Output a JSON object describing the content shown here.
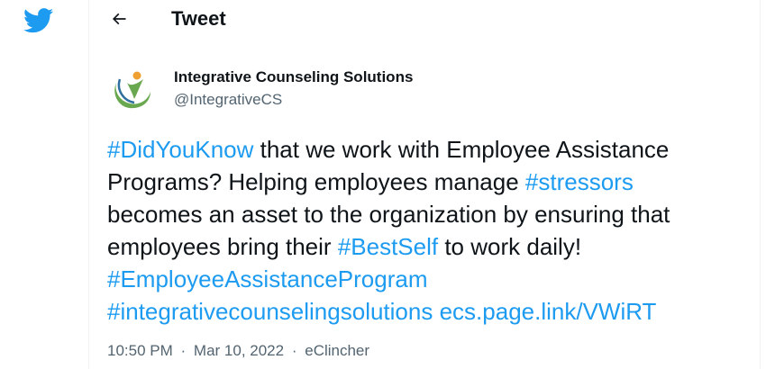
{
  "header": {
    "back_icon": "arrow-left-icon",
    "title": "Tweet"
  },
  "brand": {
    "logo_icon": "twitter-bird-icon",
    "color": "#1d9bf0"
  },
  "author": {
    "avatar_icon": "integrative-counseling-logo",
    "name": "Integrative Counseling Solutions",
    "handle": "@IntegrativeCS"
  },
  "tweet": {
    "segments": {
      "s1": "#DidYouKnow",
      "s2": " that we work with Employee Assistance",
      "s3": "Programs? Helping employees manage ",
      "s4": "#stressors",
      "s5": "becomes an asset to the organization by ensuring that",
      "s6": "employees bring their ",
      "s7": "#BestSelf",
      "s8": " to work daily!",
      "s9": "#EmployeeAssistanceProgram",
      "s10": "#integrativecounselingsolutions",
      "s11": " ",
      "s12": "ecs.page.link/VWiRT"
    }
  },
  "meta": {
    "time": "10:50 PM",
    "separator1": "·",
    "date": "Mar 10, 2022",
    "separator2": "·",
    "source": "eClincher"
  },
  "colors": {
    "link": "#1d9bf0",
    "text": "#0f1419",
    "secondary": "#536471",
    "border": "#eff3f4"
  }
}
